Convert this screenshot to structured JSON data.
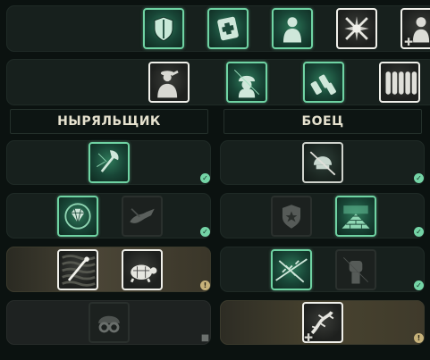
{
  "columns": {
    "left_title": "НЫРЯЛЬЩИК",
    "right_title": "БОЕЦ"
  },
  "top_rows": [
    {
      "icons": [
        "shield-icon",
        "medkit-icon",
        "person-silhouette-icon",
        "crossed-rifles-icon",
        "medic-partial-icon"
      ]
    },
    {
      "icons": [
        "saluting-soldier-icon",
        "soldier-helmet-icon",
        "ammo-shells-icon",
        "ammo-rack-icon"
      ]
    }
  ],
  "left_rows": [
    {
      "icons": [
        "axe-icon"
      ],
      "status": "check"
    },
    {
      "icons": [
        "diamond-icon",
        "crocodile-icon"
      ],
      "status": "check"
    },
    {
      "icons": [
        "diver-icon",
        "turtle-icon"
      ],
      "status": "warning"
    },
    {
      "icons": [
        "goggles-helmet-icon"
      ],
      "status": "locked"
    }
  ],
  "right_rows": [
    {
      "icons": [
        "helmet-crossed-icon"
      ],
      "status": "check"
    },
    {
      "icons": [
        "police-badge-icon",
        "brick-wall-icon"
      ],
      "status": "check"
    },
    {
      "icons": [
        "barbed-wire-icon",
        "fist-icon"
      ],
      "status": "check"
    },
    {
      "icons": [
        "lizard-icon"
      ],
      "status": "warning"
    }
  ],
  "badge_glyphs": {
    "check": "✓",
    "warning": "!",
    "locked": "🔒"
  },
  "colors": {
    "active_border": "#6fd3a3",
    "check_badge": "#74d4a6",
    "warning_badge": "#c7b27a"
  }
}
